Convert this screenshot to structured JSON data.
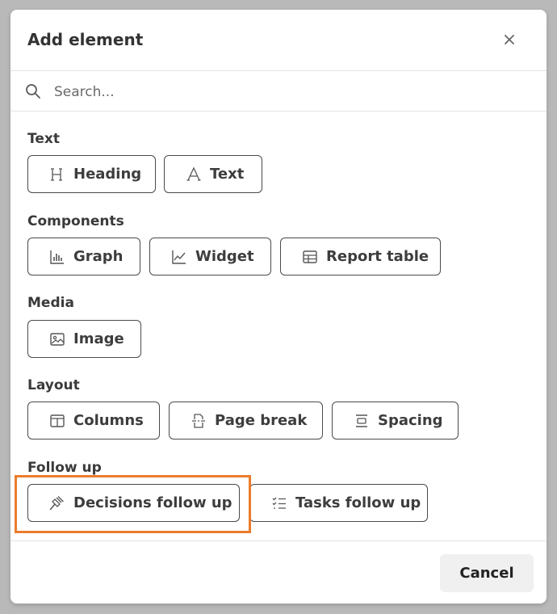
{
  "dialog": {
    "title": "Add element",
    "close_icon": "close-icon",
    "search": {
      "placeholder": "Search...",
      "value": ""
    },
    "cancel_label": "Cancel"
  },
  "sections": {
    "text": {
      "label": "Text",
      "items": [
        {
          "label": "Heading",
          "icon": "heading-icon"
        },
        {
          "label": "Text",
          "icon": "text-icon"
        }
      ]
    },
    "components": {
      "label": "Components",
      "items": [
        {
          "label": "Graph",
          "icon": "bar-chart-icon"
        },
        {
          "label": "Widget",
          "icon": "line-chart-icon"
        },
        {
          "label": "Report table",
          "icon": "table-icon"
        }
      ]
    },
    "media": {
      "label": "Media",
      "items": [
        {
          "label": "Image",
          "icon": "image-icon"
        }
      ]
    },
    "layout": {
      "label": "Layout",
      "items": [
        {
          "label": "Columns",
          "icon": "columns-icon"
        },
        {
          "label": "Page break",
          "icon": "page-break-icon"
        },
        {
          "label": "Spacing",
          "icon": "spacing-icon"
        }
      ]
    },
    "follow_up": {
      "label": "Follow up",
      "items": [
        {
          "label": "Decisions follow up",
          "icon": "gavel-icon"
        },
        {
          "label": "Tasks follow up",
          "icon": "checklist-icon"
        }
      ]
    }
  },
  "colors": {
    "highlight": "#ec7c2c",
    "chip_border": "#4a4a4a",
    "overlay": "#b9b9b9"
  }
}
